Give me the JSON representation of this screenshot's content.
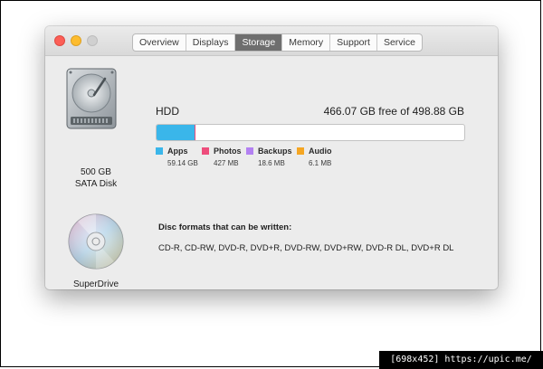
{
  "window": {
    "tabs": [
      {
        "label": "Overview"
      },
      {
        "label": "Displays"
      },
      {
        "label": "Storage"
      },
      {
        "label": "Memory"
      },
      {
        "label": "Support"
      },
      {
        "label": "Service"
      }
    ],
    "active_tab": "Storage"
  },
  "disk": {
    "caption_line1": "500 GB",
    "caption_line2": "SATA Disk",
    "name": "HDD",
    "free_text": "466.07 GB free of 498.88 GB",
    "usage_fraction": 0.123,
    "categories": [
      {
        "label": "Apps",
        "size": "59.14 GB",
        "color": "#3ab6ea"
      },
      {
        "label": "Photos",
        "size": "427 MB",
        "color": "#ee4d7c"
      },
      {
        "label": "Backups",
        "size": "18.6 MB",
        "color": "#b381f2"
      },
      {
        "label": "Audio",
        "size": "6.1 MB",
        "color": "#f5a623"
      }
    ]
  },
  "drive": {
    "caption": "SuperDrive",
    "formats_title": "Disc formats that can be written:",
    "formats_list": "CD-R, CD-RW, DVD-R, DVD+R, DVD-RW, DVD+RW, DVD-R DL, DVD+R DL"
  },
  "watermark": "[698x452] https://upic.me/"
}
